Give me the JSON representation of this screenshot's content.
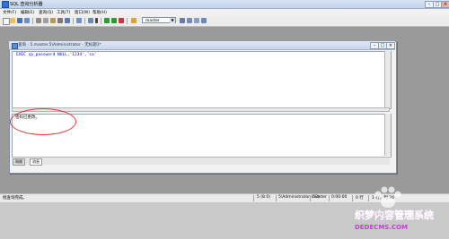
{
  "window": {
    "title": "SQL 查询分析器"
  },
  "menu": {
    "items": [
      "文件(F)",
      "编辑(E)",
      "查询(Q)",
      "工具(T)",
      "窗口(W)",
      "帮助(H)"
    ]
  },
  "toolbar": {
    "database": "master"
  },
  "query_window": {
    "title": "查询 - 5.master.5\\Administrator - 无标题1*",
    "sql": "EXEC  sp_password NULL,'1234','sa'",
    "message": "密码已更改。",
    "tabs": [
      "网格",
      "消息"
    ]
  },
  "statusbar": {
    "message": "批查询完成。",
    "server": "5 (8.0)",
    "user": "5\\Administrator (52)",
    "db": "master",
    "time": "0:00:00",
    "rows": "0 行",
    "position": "1 行，列 34"
  },
  "watermark": {
    "line1": "织梦内容管理系统",
    "line2": "DEDECMS.COM"
  }
}
